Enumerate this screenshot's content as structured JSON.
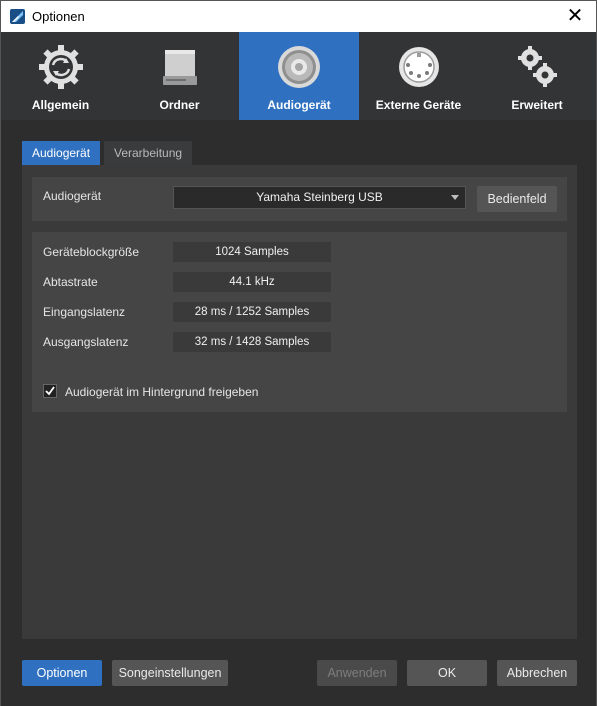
{
  "window": {
    "title": "Optionen",
    "close_glyph": "✕"
  },
  "categories": [
    {
      "label": "Allgemein",
      "icon": "refresh-gear-icon",
      "active": false
    },
    {
      "label": "Ordner",
      "icon": "drive-icon",
      "active": false
    },
    {
      "label": "Audiogerät",
      "icon": "speaker-icon",
      "active": true
    },
    {
      "label": "Externe Geräte",
      "icon": "midi-port-icon",
      "active": false
    },
    {
      "label": "Erweitert",
      "icon": "gears-icon",
      "active": false
    }
  ],
  "tabs": [
    {
      "label": "Audiogerät",
      "active": true
    },
    {
      "label": "Verarbeitung",
      "active": false
    }
  ],
  "device": {
    "label": "Audiogerät",
    "selected": "Yamaha Steinberg USB",
    "control_panel_label": "Bedienfeld"
  },
  "settings": [
    {
      "label": "Geräteblockgröße",
      "value": "1024 Samples"
    },
    {
      "label": "Abtastrate",
      "value": "44.1 kHz"
    },
    {
      "label": "Eingangslatenz",
      "value": "28 ms / 1252 Samples"
    },
    {
      "label": "Ausgangslatenz",
      "value": "32 ms / 1428 Samples"
    }
  ],
  "release_in_background": {
    "label": "Audiogerät im Hintergrund freigeben",
    "checked": true
  },
  "footer": {
    "options": "Optionen",
    "song_settings": "Songeinstellungen",
    "apply": "Anwenden",
    "ok": "OK",
    "cancel": "Abbrechen"
  },
  "colors": {
    "accent": "#2f71c0",
    "background": "#2e2e2e",
    "panel": "#454545"
  }
}
